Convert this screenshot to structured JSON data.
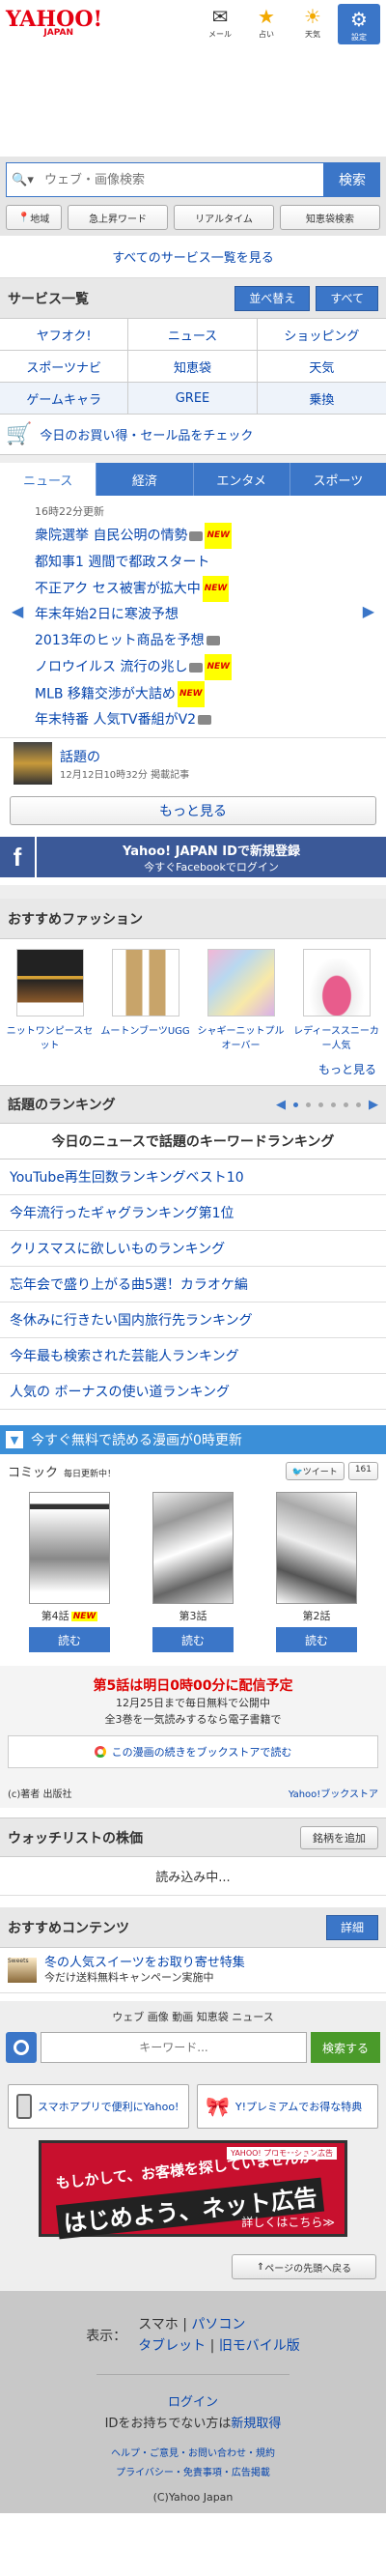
{
  "header": {
    "logo": "YAHOO!",
    "logo_sub": "JAPAN",
    "icons": [
      {
        "icon": "mail-icon",
        "label": "メール"
      },
      {
        "icon": "star-icon",
        "label": "占い"
      },
      {
        "icon": "weather-icon",
        "label": "天気"
      },
      {
        "icon": "gear-icon",
        "label": "設定"
      }
    ]
  },
  "search": {
    "placeholder": "ウェブ・画像検索",
    "button": "検索",
    "subbuttons": [
      "地域",
      "急上昇ワード",
      "リアルタイム",
      "知恵袋検索"
    ]
  },
  "center_link": "すべてのサービス一覧を見る",
  "services": {
    "title": "サービス一覧",
    "btn_edit": "並べ替え",
    "btn_all": "すべて",
    "items": [
      "ヤフオク!",
      "ニュース",
      "ショッピング",
      "スポーツナビ",
      "知恵袋",
      "天気",
      "ゲームキャラ",
      "GREE",
      "乗換"
    ]
  },
  "shopping_row": "今日のお買い得・セール品をチェック",
  "news": {
    "tabs": [
      "ニュース",
      "経済",
      "エンタメ",
      "スポーツ"
    ],
    "date": "16時22分更新",
    "items": [
      {
        "text": "衆院選挙 自民公明の情勢",
        "cam": true,
        "new": true
      },
      {
        "text": "都知事1 週間で都政スタート",
        "cam": false,
        "new": false
      },
      {
        "text": "不正アク セス被害が拡大中",
        "cam": false,
        "new": true
      },
      {
        "text": "年末年始2日に寒波予想",
        "cam": false,
        "new": false
      },
      {
        "text": "2013年のヒット商品を予想",
        "cam": true,
        "new": false
      },
      {
        "text": "ノロウイルス 流行の兆し",
        "cam": true,
        "new": true
      },
      {
        "text": "MLB 移籍交渉が大詰め",
        "cam": false,
        "new": true
      },
      {
        "text": "年末特番 人気TV番組がV2",
        "cam": true,
        "new": false
      }
    ],
    "topic_title": "話題の",
    "topic_sub": "12月12日10時32分 掲載記事",
    "more": "もっと見る"
  },
  "facebook": {
    "title": "Yahoo! JAPAN IDで新規登録",
    "sub": "今すぐFacebookでログイン"
  },
  "fashion": {
    "title": "おすすめファッション",
    "items": [
      "ニットワンピースセット",
      "ムートンブーツUGG",
      "シャギーニットプルオーバー",
      "レディーススニーカー人気"
    ],
    "more": "もっと見る"
  },
  "ranking": {
    "title": "話題のランキング",
    "headline": "今日のニュースで話題のキーワードランキング",
    "items": [
      "YouTube再生回数ランキングベスト10",
      "今年流行ったギャグランキング第1位",
      "クリスマスに欲しいものランキング",
      "忘年会で盛り上がる曲5選！カラオケ編",
      "冬休みに行きたい国内旅行先ランキング",
      "今年最も検索された芸能人ランキング",
      "人気の ボーナスの使い道ランキング"
    ]
  },
  "manga": {
    "header": "今すぐ無料で読める漫画が0時更新",
    "title": "コミック",
    "title_small": "毎日更新中！",
    "tweet": "ツイート",
    "tweet_count": "161",
    "items": [
      {
        "label": "第4話",
        "new": true,
        "button": "読む"
      },
      {
        "label": "第3話",
        "new": false,
        "button": "読む"
      },
      {
        "label": "第2話",
        "new": false,
        "button": "読む"
      }
    ],
    "promo_red": "第5話は明日0時00分に配信予定",
    "promo_line1": "12月25日まで毎日無料で公開中",
    "promo_line2": "全3巻を一気読みするなら電子書籍で",
    "promo_button": "この漫画の続きをブックストアで読む",
    "footer_left": "(c)著者 出版社",
    "footer_right": "Yahoo!ブックストア"
  },
  "watchlist": {
    "title": "ウォッチリストの株価",
    "button": "銘柄を追加",
    "loading": "読み込み中..."
  },
  "ad": {
    "title": "おすすめコンテンツ",
    "button": "詳細",
    "line1": "冬の人気スイーツをお取り寄せ特集",
    "line2": "今だけ送料無料キャンペーン実施中",
    "img_label": "Sweets"
  },
  "bottom_search": {
    "links": "ウェブ 画像 動画 知恵袋 ニュース",
    "placeholder": "キーワード...",
    "button": "検索する"
  },
  "promos": [
    {
      "icon": "phone-icon",
      "text": "スマホアプリで便利にYahoo!"
    },
    {
      "icon": "gift-icon",
      "text": "Y!プレミアムでお得な特典"
    }
  ],
  "banner": {
    "logo": "YAHOO! プロモーション広告",
    "line1": "もしかして、お客様を探していませんか？",
    "line2": "はじめよう、ネット広告",
    "line3": "詳しくはこちら≫"
  },
  "pc_top": "ページの先頭へ戻る",
  "footer": {
    "mode_label": "表示：",
    "opt1_a": "スマホ",
    "opt1_b": "パソコン",
    "opt2_a": "タブレット",
    "opt2_b": "旧モバイル版",
    "login": "ログイン",
    "id_text": "IDをお持ちでない方は",
    "id_link": "新規取得",
    "links1": "ヘルプ・ご意見・お問い合わせ・規約",
    "links2": "プライバシー・免責事項・広告掲載",
    "copy": "(C)Yahoo Japan"
  }
}
